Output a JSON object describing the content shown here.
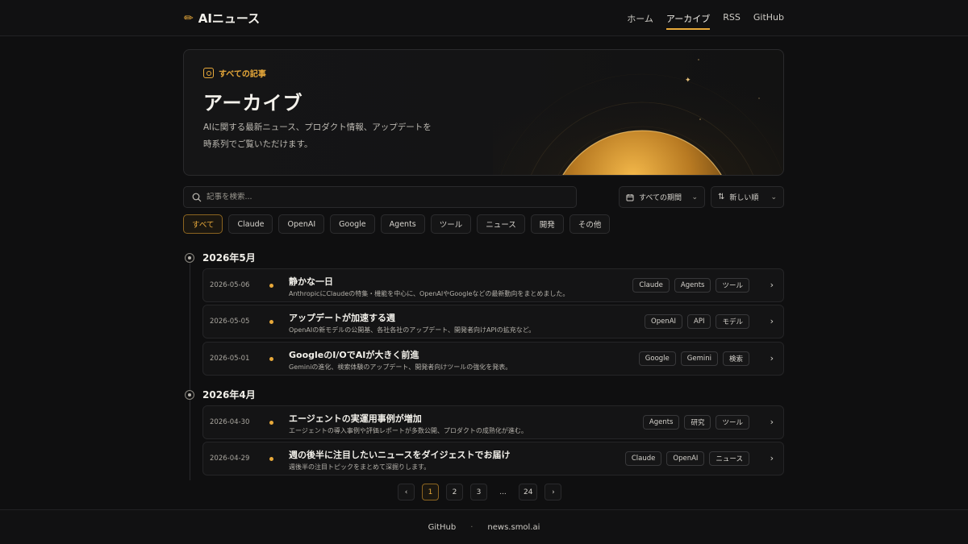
{
  "header": {
    "brand": "AIニュース",
    "nav": [
      "ホーム",
      "アーカイブ",
      "RSS",
      "GitHub"
    ],
    "active_nav": "アーカイブ"
  },
  "hero": {
    "tag": "すべての記事",
    "title": "アーカイブ",
    "desc_line1": "AIに関する最新ニュース、プロダクト情報、アップデートを",
    "desc_line2": "時系列でご覧いただけます。"
  },
  "search": {
    "placeholder": "記事を検索..."
  },
  "filters": {
    "period": "すべての期間",
    "sort": "新しい順"
  },
  "chips": [
    "すべて",
    "Claude",
    "OpenAI",
    "Google",
    "Agents",
    "ツール",
    "ニュース",
    "開発",
    "その他"
  ],
  "active_chip": "すべて",
  "months": [
    {
      "label": "2026年5月",
      "articles": [
        {
          "date": "2026-05-06",
          "title": "静かな一日",
          "desc": "AnthropicにClaudeの特集・機能を中心に、OpenAIやGoogleなどの最新動向をまとめました。",
          "tags": [
            "Claude",
            "Agents",
            "ツール"
          ]
        },
        {
          "date": "2026-05-05",
          "title": "アップデートが加速する週",
          "desc": "OpenAIの新モデルの公開基、各社各社のアップデート、開発者向けAPIの拡充など。",
          "tags": [
            "OpenAI",
            "API",
            "モデル"
          ]
        },
        {
          "date": "2026-05-01",
          "title": "GoogleのI/OでAIが大きく前進",
          "desc": "Geminiの進化、検索体験のアップデート、開発者向けツールの強化を発表。",
          "tags": [
            "Google",
            "Gemini",
            "検索"
          ]
        }
      ]
    },
    {
      "label": "2026年4月",
      "articles": [
        {
          "date": "2026-04-30",
          "title": "エージェントの実運用事例が増加",
          "desc": "エージェントの導入事例や評価レポートが多数公開、プロダクトの成熟化が進む。",
          "tags": [
            "Agents",
            "研究",
            "ツール"
          ]
        },
        {
          "date": "2026-04-29",
          "title": "週の後半に注目したいニュースをダイジェストでお届け",
          "desc": "週後半の注目トピックをまとめて深掘りします。",
          "tags": [
            "Claude",
            "OpenAI",
            "ニュース"
          ]
        }
      ]
    }
  ],
  "pagination": {
    "prev": "‹",
    "pages": [
      "1",
      "2",
      "3",
      "...",
      "24"
    ],
    "current": "1",
    "next": "›"
  },
  "footer": {
    "link1": "GitHub",
    "separator": "·",
    "link2": "news.smol.ai"
  },
  "colors": {
    "accent": "#e8a93a",
    "background": "#0f0f10"
  }
}
